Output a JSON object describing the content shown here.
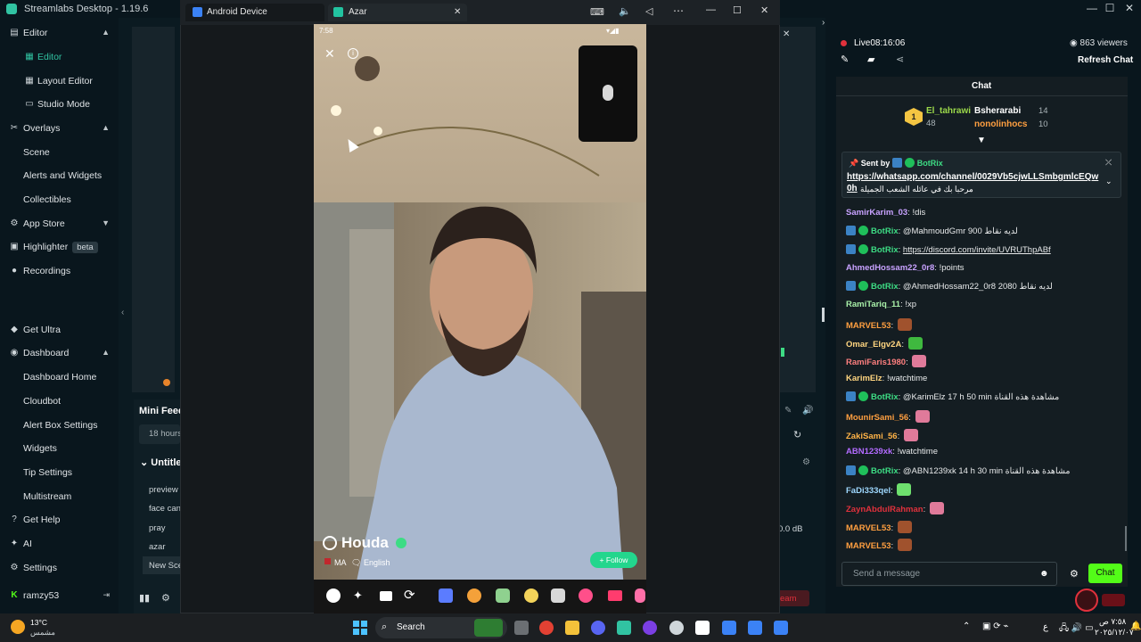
{
  "app": {
    "title": "Streamlabs Desktop - 1.19.6"
  },
  "sidebar": {
    "editor": "Editor",
    "editor_sub": "Editor",
    "layout_editor": "Layout Editor",
    "studio_mode": "Studio Mode",
    "overlays": "Overlays",
    "scene": "Scene",
    "alerts_widgets": "Alerts and Widgets",
    "collectibles": "Collectibles",
    "app_store": "App Store",
    "highlighter": "Highlighter",
    "beta": "beta",
    "recordings": "Recordings",
    "get_ultra": "Get Ultra",
    "dashboard": "Dashboard",
    "dashboard_home": "Dashboard Home",
    "cloudbot": "Cloudbot",
    "alert_box": "Alert Box Settings",
    "widgets": "Widgets",
    "tip_settings": "Tip Settings",
    "multistream": "Multistream",
    "get_help": "Get Help",
    "ai": "AI",
    "settings": "Settings",
    "user": "ramzy53"
  },
  "editor": {
    "mini_feed": "Mini Feed",
    "hours": "18 hours",
    "untitled": "Untitled",
    "scenes": [
      "preview",
      "face can",
      "pray",
      "azar",
      "New Sce"
    ],
    "db": "0.0 dB",
    "team": "eam"
  },
  "android": {
    "tab1": "Android Device",
    "tab2": "Azar",
    "time": "7:58",
    "name": "Houda",
    "country": "MA",
    "language": "English",
    "follow": "+ Follow"
  },
  "chat": {
    "live": "Live",
    "live_time": "08:16:06",
    "viewers": "863 viewers",
    "refresh": "Refresh Chat",
    "header": "Chat",
    "top": [
      {
        "name": "El_tahrawi",
        "n": "48"
      },
      {
        "name": "Bsherarabi",
        "n": "14"
      },
      {
        "name": "nonolinhocs",
        "n": "10"
      }
    ],
    "rank": "1",
    "pinned_by": "Sent by",
    "pinned_bot": "BotRix",
    "pinned_link": "https://whatsapp.com/channel/0029Vb5cjwLLSmbgmlcEQw",
    "pinned_link2": "0h",
    "pinned_text": "مرحبا بك في عائله الشعب الجميلة",
    "messages": [
      {
        "u": "SamirKarim_03",
        "c": "#c8a2ff",
        "t": "!dis"
      },
      {
        "u": "BotRix",
        "c": "#3ddc84",
        "t": "@MahmoudGmr 900 لديه نقاط",
        "bot": true
      },
      {
        "u": "BotRix",
        "c": "#3ddc84",
        "t": "https://discord.com/invite/UVRUThpABf",
        "bot": true,
        "link": true
      },
      {
        "u": "AhmedHossam22_0r8",
        "c": "#c8a2ff",
        "t": "!points"
      },
      {
        "u": "BotRix",
        "c": "#3ddc84",
        "t": "@AhmedHossam22_0r8 2080 لديه نقاط",
        "bot": true
      },
      {
        "u": "RamiTariq_11",
        "c": "#a8f0a8",
        "t": "!xp"
      },
      {
        "u": "MARVEL53",
        "c": "#ff9f40",
        "t": "",
        "emote": "#a0522d"
      },
      {
        "u": "Omar_Elgv2A",
        "c": "#ffd580",
        "t": "",
        "emote": "#3fb93f"
      },
      {
        "u": "RamiFaris1980",
        "c": "#ff7f7f",
        "t": "",
        "emote": "#e07a9a"
      },
      {
        "u": "KarimElz",
        "c": "#ffd580",
        "t": "!watchtime"
      },
      {
        "u": "BotRix",
        "c": "#3ddc84",
        "t": "@KarimElz 17 h 50 min مشاهدة هذه القناة",
        "bot": true
      },
      {
        "u": "MounirSami_56",
        "c": "#ff9f40",
        "t": "",
        "emote": "#e07a9a"
      },
      {
        "u": "ZakiSami_56",
        "c": "#ffb347",
        "t": "",
        "emote": "#e07a9a"
      },
      {
        "u": "ABN1239xk",
        "c": "#b36bff",
        "t": "!watchtime"
      },
      {
        "u": "BotRix",
        "c": "#3ddc84",
        "t": "@ABN1239xk 14 h 30 min مشاهدة هذه القناة",
        "bot": true
      },
      {
        "u": "FaDi333qel",
        "c": "#9fd8ff",
        "t": "",
        "emote": "#6ee06e"
      },
      {
        "u": "ZaynAbdulRahman",
        "c": "#e0313c",
        "t": "",
        "emote": "#e07a9a"
      },
      {
        "u": "MARVEL53",
        "c": "#ff9f40",
        "t": "",
        "emote": "#a0522d"
      },
      {
        "u": "MARVEL53",
        "c": "#ff9f40",
        "t": "",
        "emote": "#a0522d"
      }
    ],
    "placeholder": "Send a message",
    "chat_button": "Chat"
  },
  "taskbar": {
    "temp": "13°C",
    "weather": "مشمس",
    "search": "Search",
    "clock_time": "٧:٥٨ ص",
    "clock_date": "٢٠٢٥/١٢/٠٧",
    "lang": "ع"
  }
}
